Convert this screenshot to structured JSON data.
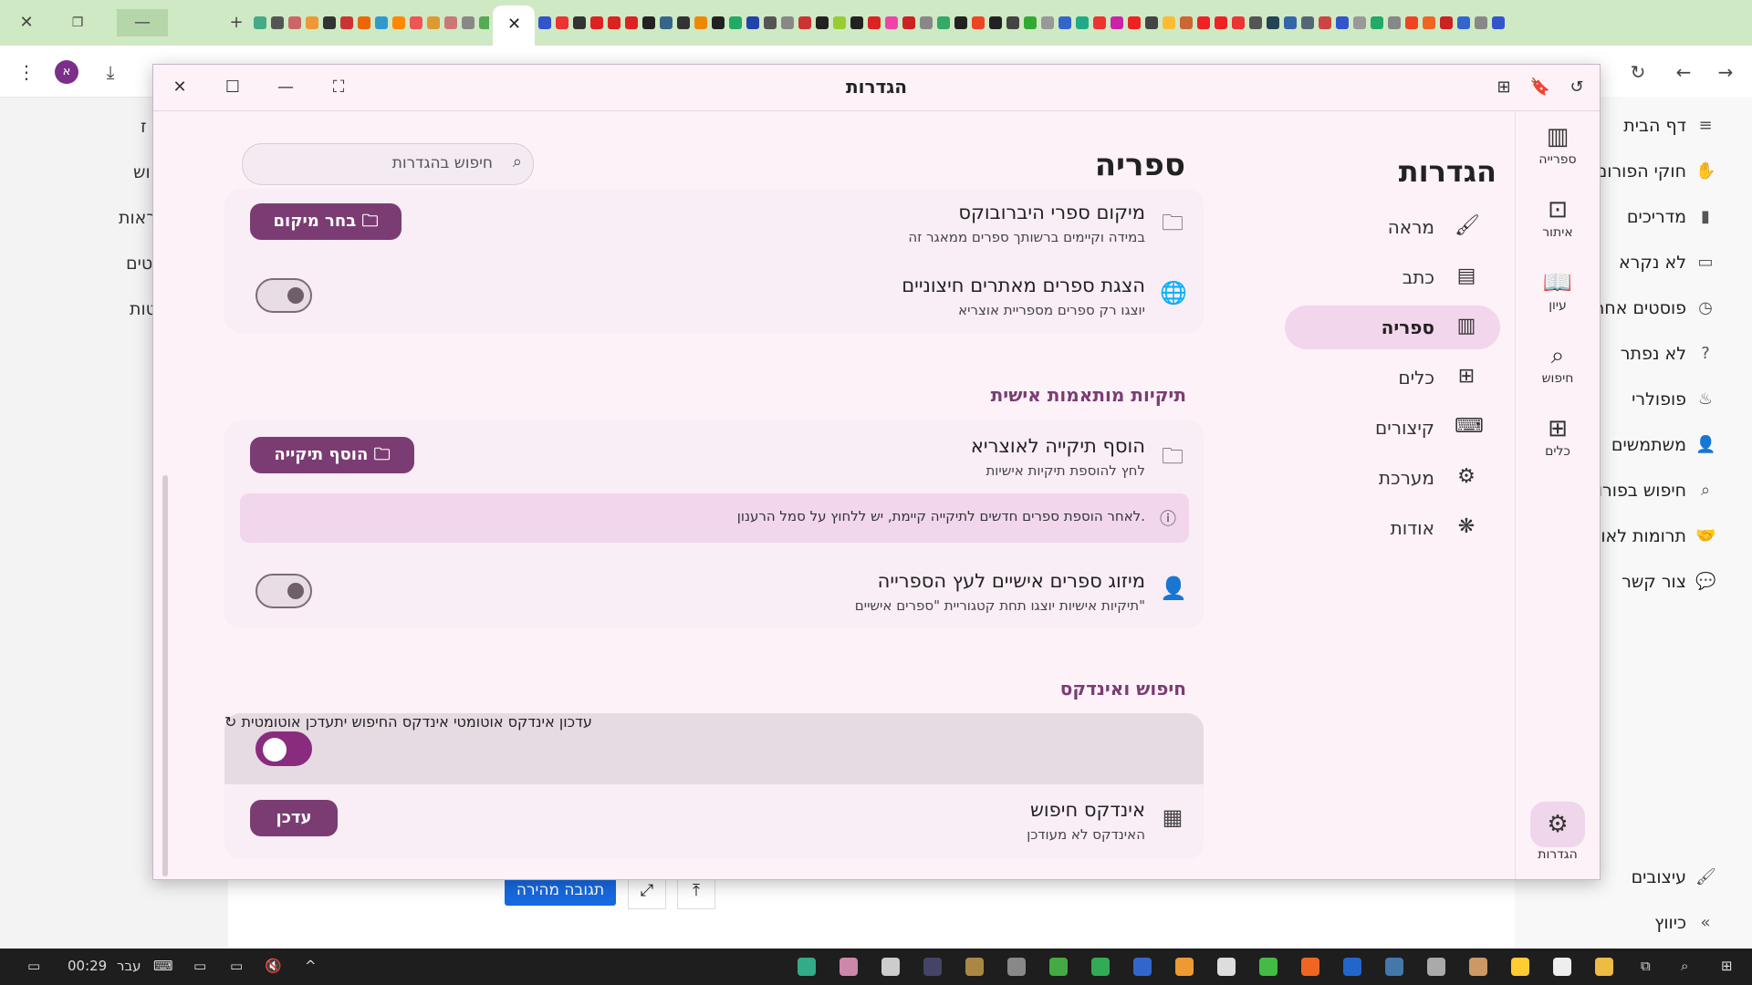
{
  "browser": {
    "tabs_icons": [
      "close-icon",
      "restore-icon",
      "minimize-icon"
    ],
    "active_tab_close": "✕",
    "new_tab": "+",
    "toolbar": {
      "avatar_letter": "א"
    }
  },
  "page": {
    "sidebar": [
      {
        "label": "דף הבית",
        "icon": "menu-icon"
      },
      {
        "label": "חוקי הפורום",
        "icon": "hand-icon"
      },
      {
        "label": "מדריכים",
        "icon": "book-icon"
      },
      {
        "label": "לא נקרא",
        "icon": "inbox-icon"
      },
      {
        "label": "פוסטים אחרו",
        "icon": "clock-icon"
      },
      {
        "label": "לא נפתר",
        "icon": "question-icon"
      },
      {
        "label": "פופולרי",
        "icon": "fire-icon"
      },
      {
        "label": "משתמשים",
        "icon": "user-icon"
      },
      {
        "label": "חיפוש בפורו",
        "icon": "search-icon"
      },
      {
        "label": "תרומות לאוצ",
        "icon": "handshake-icon"
      },
      {
        "label": "צור קשר",
        "icon": "chat-icon"
      }
    ],
    "sidebar_bottom": [
      {
        "label": "עיצובים",
        "icon": "brush-icon"
      },
      {
        "label": "כיווץ",
        "icon": "collapse-icon"
      }
    ],
    "left_fragments": [
      "ז",
      "וש",
      "ראות",
      "טים",
      "טות"
    ],
    "quick_reply": "תגובה מהירה"
  },
  "window": {
    "title": "הגדרות",
    "rail": [
      {
        "label": "ספרייה",
        "icon": "library-icon"
      },
      {
        "label": "איתור",
        "icon": "locate-icon"
      },
      {
        "label": "עיון",
        "icon": "open-book-icon"
      },
      {
        "label": "חיפוש",
        "icon": "search-icon"
      },
      {
        "label": "כלים",
        "icon": "tools-icon"
      }
    ],
    "rail_settings": {
      "label": "הגדרות",
      "icon": "gear-icon"
    },
    "categories_heading": "הגדרות",
    "categories": [
      {
        "label": "מראה",
        "icon": "brush-icon",
        "active": false
      },
      {
        "label": "כתב",
        "icon": "document-icon",
        "active": false
      },
      {
        "label": "ספריה",
        "icon": "library-icon",
        "active": true
      },
      {
        "label": "כלים",
        "icon": "widgets-icon",
        "active": false
      },
      {
        "label": "קיצורים",
        "icon": "keyboard-icon",
        "active": false
      },
      {
        "label": "מערכת",
        "icon": "gear-icon",
        "active": false
      },
      {
        "label": "אודות",
        "icon": "team-icon",
        "active": false
      }
    ],
    "content_heading": "ספריה",
    "search_placeholder": "חיפוש בהגדרות",
    "card1": {
      "row1": {
        "title": "מיקום ספרי היברובוקס",
        "subtitle": "במידה וקיימים ברשותך ספרים ממאגר זה",
        "button": "בחר מיקום"
      },
      "row2": {
        "title": "הצגת ספרים מאתרים חיצוניים",
        "subtitle": "יוצגו רק ספרים מספריית אוצריא",
        "toggle": true
      }
    },
    "section2_title": "תיקיות מותאמות אישית",
    "card2": {
      "row1": {
        "title": "הוסף תיקייה לאוצריא",
        "subtitle": "לחץ להוספת תיקיות אישיות",
        "button": "הוסף תיקייה"
      },
      "info": "לאחר הוספת ספרים חדשים לתיקייה קיימת, יש ללחוץ על סמל הרענון.",
      "row2": {
        "title": "מיזוג ספרים אישיים לעץ הספרייה",
        "subtitle": "תיקיות אישיות יוצגו תחת קטגוריית \"ספרים אישיים\"",
        "toggle": true
      }
    },
    "section3_title": "חיפוש ואינדקס",
    "card3": {
      "row1": {
        "title": "עדכון אינדקס אוטומטי",
        "subtitle": "אינדקס החיפוש יתעדכן אוטומטית",
        "toggle": false
      },
      "row2": {
        "title": "אינדקס חיפוש",
        "subtitle": "האינדקס לא מעודכן",
        "button": "עדכן"
      }
    }
  },
  "taskbar": {
    "time": "00:29",
    "lang": "עבר"
  },
  "colors": {
    "accent": "#7b3c73",
    "window_bg": "#fcf2f8",
    "active_category": "#f2d6ec",
    "tab_strip": "#cfe9c4"
  }
}
